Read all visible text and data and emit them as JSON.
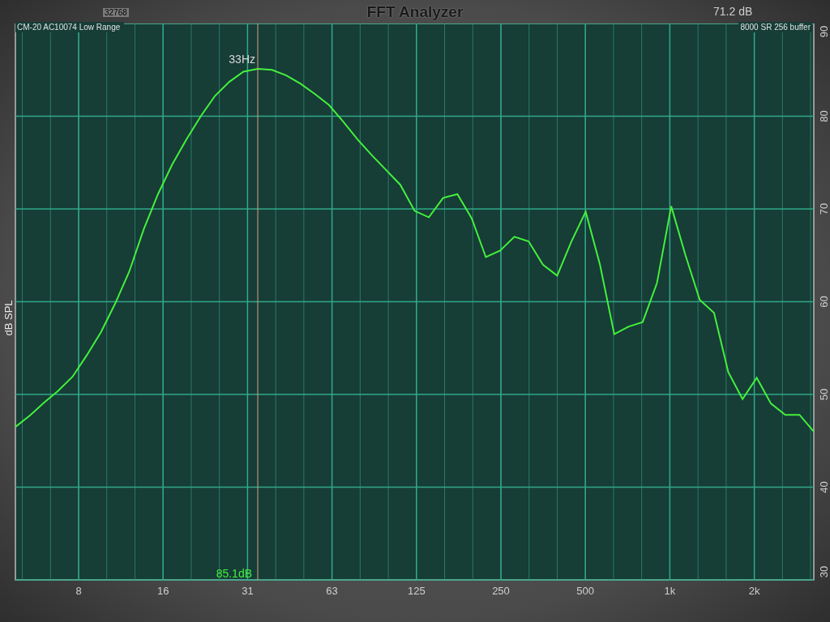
{
  "window": {
    "title": "FFT Analyzer"
  },
  "header": {
    "counter": "32768",
    "level_reading": "71.2 dB"
  },
  "plot": {
    "device_label": "CM-20 AC10074 Low Range",
    "settings_label": "8000 SR 256 buffer",
    "cursor_frequency": "33Hz",
    "cursor_level": "85.1dB",
    "frequency_labels": [
      "8",
      "16",
      "31",
      "63",
      "125",
      "250",
      "500",
      "1k",
      "2k"
    ],
    "chart_data": {
      "type": "line",
      "grid": true,
      "ylabel": "dB SPL",
      "ylim": [
        30,
        90
      ],
      "yticks": [
        30,
        40,
        50,
        60,
        70,
        80,
        90
      ],
      "series": [
        {
          "color": "#44f03c",
          "values": [
            46.5,
            47.7,
            49.1,
            50.4,
            51.9,
            54.2,
            56.7,
            59.8,
            63.3,
            67.8,
            71.6,
            74.8,
            77.5,
            80.0,
            82.2,
            83.7,
            84.8,
            85.1,
            85.0,
            84.4,
            83.5,
            82.4,
            81.2,
            79.4,
            77.5,
            75.8,
            74.2,
            72.6,
            69.8,
            69.1,
            71.2,
            71.6,
            69.0,
            64.8,
            65.5,
            67.0,
            66.5,
            64.0,
            62.8,
            66.5,
            69.7,
            64.0,
            56.5,
            57.3,
            57.8,
            62.0,
            70.3,
            65.0,
            60.2,
            58.8,
            52.4,
            49.5,
            51.8,
            49.0,
            47.8,
            47.8,
            46.0
          ]
        }
      ]
    }
  }
}
